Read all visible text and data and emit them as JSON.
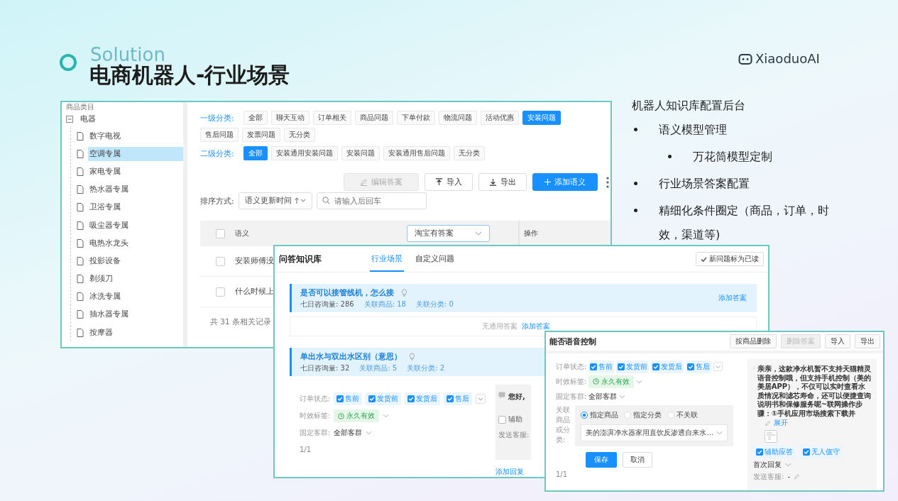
{
  "slide": {
    "subtitle": "Solution",
    "title": "电商机器人-行业场景",
    "logo": "XiaoduoAI"
  },
  "knowledge_admin": {
    "sidebar": {
      "heading": "商品类目",
      "tree": [
        {
          "label": "电器",
          "expanded": true,
          "children": [
            {
              "label": "数字电视",
              "selected": false
            },
            {
              "label": "空调专属",
              "selected": true
            },
            {
              "label": "家电专属",
              "selected": false
            },
            {
              "label": "热水器专属",
              "selected": false
            },
            {
              "label": "卫浴专属",
              "selected": false
            },
            {
              "label": "吸尘器专属",
              "selected": false
            },
            {
              "label": "电热水龙头",
              "selected": false
            },
            {
              "label": "投影设备",
              "selected": false
            },
            {
              "label": "剃须刀",
              "selected": false
            },
            {
              "label": "冰洗专属",
              "selected": false
            },
            {
              "label": "抽水器专属",
              "selected": false
            },
            {
              "label": "按摩器",
              "selected": false
            }
          ]
        }
      ]
    },
    "level1_label": "一级分类:",
    "level1_tags": [
      {
        "label": "全部",
        "selected": false
      },
      {
        "label": "聊天互动",
        "selected": false
      },
      {
        "label": "订单相关",
        "selected": false
      },
      {
        "label": "商品问题",
        "selected": false
      },
      {
        "label": "下单付款",
        "selected": false
      },
      {
        "label": "物流问题",
        "selected": false
      },
      {
        "label": "活动优惠",
        "selected": false
      },
      {
        "label": "安装问题",
        "selected": true
      },
      {
        "label": "售后问题",
        "selected": false
      },
      {
        "label": "发票问题",
        "selected": false
      },
      {
        "label": "无分类",
        "selected": false
      }
    ],
    "level2_label": "二级分类:",
    "level2_tags": [
      {
        "label": "全部",
        "selected": true
      },
      {
        "label": "安装通用安装问题",
        "selected": false
      },
      {
        "label": "安装问题",
        "selected": false
      },
      {
        "label": "安装通用售后问题",
        "selected": false
      },
      {
        "label": "无分类",
        "selected": false
      }
    ],
    "toolbar": [
      {
        "label": "编辑答案",
        "kind": "edit",
        "disabled": true
      },
      {
        "label": "导入",
        "kind": "import",
        "disabled": false
      },
      {
        "label": "导出",
        "kind": "export",
        "disabled": false
      },
      {
        "label": "添加语义",
        "kind": "add",
        "disabled": false
      }
    ],
    "sort_label": "排序方式:",
    "sort_value": "语义更新时间",
    "search": {
      "placeholder": "请输入后回车"
    },
    "table": {
      "columns": [
        "语义",
        "操作"
      ],
      "select_all": {
        "checked": false
      },
      "filter": "淘宝有答案",
      "rows": [
        {
          "text": "安装师傅没",
          "checked": false
        },
        {
          "text": "什么时候上",
          "checked": false
        }
      ]
    },
    "footer": "共 31 条相关记录"
  },
  "qa_library": {
    "title": "问答知识库",
    "tabs": [
      {
        "label": "行业场景",
        "selected": true
      },
      {
        "label": "自定义问题",
        "selected": false
      }
    ],
    "mark_read": "新问题标为已读",
    "question_1": {
      "title": "是否可以接管线机，怎么接",
      "stats": [
        {
          "label": "七日咨询量:",
          "value": "286"
        },
        {
          "label": "关联商品:",
          "value": "18"
        },
        {
          "label": "关联分类:",
          "value": "0"
        }
      ],
      "add_answer": "添加答案",
      "no_answer": "无通用答案",
      "answer_link": "添加答案"
    },
    "question_2": {
      "title": "单出水与双出水区别（意思）",
      "stats": [
        {
          "label": "七日咨询量:",
          "value": "32"
        },
        {
          "label": "关联商品:",
          "value": "5"
        },
        {
          "label": "关联分类:",
          "value": "2"
        }
      ],
      "order_label": "订单状态:",
      "order_options": [
        {
          "label": "售前",
          "checked": true
        },
        {
          "label": "发货前",
          "checked": true
        },
        {
          "label": "发货后",
          "checked": true
        },
        {
          "label": "售后",
          "checked": true
        }
      ],
      "validity_label": "时效标签:",
      "validity": "永久有效",
      "audience_label": "固定客群:",
      "audience": "全部客群",
      "page": "1/1",
      "reply": "您好,",
      "assist": {
        "label": "辅助",
        "checked": false
      },
      "send_label": "发送客服:",
      "add_reply": "添加回复"
    }
  },
  "answer_editor": {
    "title": "能否语音控制",
    "buttons": [
      {
        "label": "按商品删除",
        "disabled": false
      },
      {
        "label": "删除答案",
        "disabled": true
      },
      {
        "label": "导入",
        "disabled": false
      },
      {
        "label": "导出",
        "disabled": false
      }
    ],
    "order_label": "订单状态:",
    "order_options": [
      {
        "label": "售前",
        "checked": true
      },
      {
        "label": "发货前",
        "checked": true
      },
      {
        "label": "发货后",
        "checked": true
      },
      {
        "label": "售后",
        "checked": true
      }
    ],
    "validity_label": "时效标签:",
    "validity": "永久有效",
    "audience_label": "固定客群:",
    "audience": "全部客群",
    "link_label": "关联商品或分类:",
    "link_options": [
      {
        "label": "指定商品",
        "selected": true
      },
      {
        "label": "指定分类",
        "selected": false
      },
      {
        "label": "不关联",
        "selected": false
      }
    ],
    "product": "美的澎湃净水器家用直饮反渗透自来水...",
    "save": "保存",
    "cancel": "取消",
    "page": "1/1",
    "reply": "亲亲，这款净水机暂不支持天猫精灵语音控制哦，但支持手机控制（美的美居APP），不仅可以实时查看水质情况和滤芯寿命，还可以便捷查询说明书和保修服务呢~联网操作步骤：①手机应用市场搜索下载并",
    "expand": "展开",
    "reply_options": [
      {
        "label": "辅助应答",
        "checked": true
      },
      {
        "label": "无人值守",
        "checked": true
      }
    ],
    "first_reply": "首次回复",
    "send_label": "发送客服:",
    "send_value": "-"
  },
  "notes": {
    "heading": "机器人知识库配置后台",
    "items": [
      {
        "text": "语义模型管理",
        "children": [
          {
            "text": "万花筒模型定制"
          }
        ]
      },
      {
        "text": "行业场景答案配置"
      },
      {
        "text": "精细化条件圈定（商品，订单，时效，渠道等)"
      }
    ]
  }
}
